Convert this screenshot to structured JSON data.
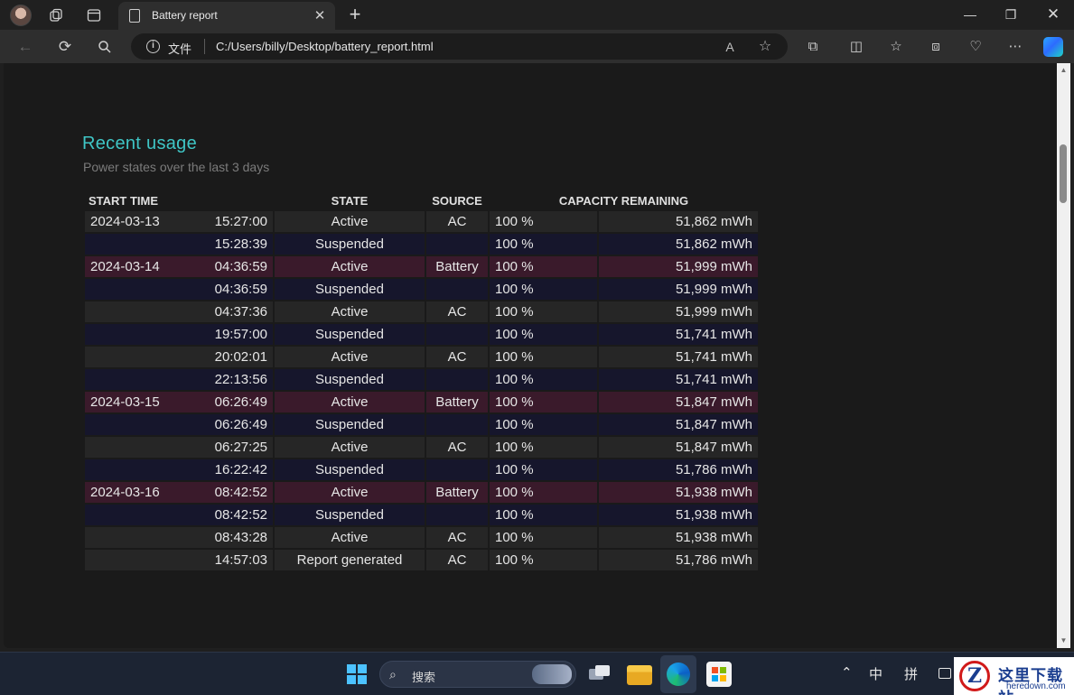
{
  "browser": {
    "tab_title": "Battery report",
    "address_scheme": "文件",
    "address_url": "C:/Users/billy/Desktop/battery_report.html",
    "icons": [
      "profile-avatar",
      "workspaces-icon",
      "tab-actions-icon",
      "page-icon",
      "close-icon",
      "new-tab-icon",
      "minimize-icon",
      "maximize-icon",
      "window-close-icon",
      "back-icon",
      "refresh-icon",
      "search-icon",
      "info-icon",
      "read-aloud-icon",
      "favorite-star-icon",
      "extensions-icon",
      "split-screen-icon",
      "favorites-icon",
      "collections-icon",
      "browser-essentials-icon",
      "more-icon",
      "copilot-icon"
    ]
  },
  "report": {
    "heading": "Recent usage",
    "subheading": "Power states over the last 3 days",
    "columns": {
      "start_time": "START TIME",
      "state": "STATE",
      "source": "SOURCE",
      "capacity": "CAPACITY REMAINING"
    },
    "rows": [
      {
        "date": "2024-03-13",
        "time": "15:27:00",
        "state": "Active",
        "source": "AC",
        "pct": "100 %",
        "mwh": "51,862 mWh",
        "kind": "ac"
      },
      {
        "date": "",
        "time": "15:28:39",
        "state": "Suspended",
        "source": "",
        "pct": "100 %",
        "mwh": "51,862 mWh",
        "kind": "suspended"
      },
      {
        "date": "2024-03-14",
        "time": "04:36:59",
        "state": "Active",
        "source": "Battery",
        "pct": "100 %",
        "mwh": "51,999 mWh",
        "kind": "battery"
      },
      {
        "date": "",
        "time": "04:36:59",
        "state": "Suspended",
        "source": "",
        "pct": "100 %",
        "mwh": "51,999 mWh",
        "kind": "suspended"
      },
      {
        "date": "",
        "time": "04:37:36",
        "state": "Active",
        "source": "AC",
        "pct": "100 %",
        "mwh": "51,999 mWh",
        "kind": "ac"
      },
      {
        "date": "",
        "time": "19:57:00",
        "state": "Suspended",
        "source": "",
        "pct": "100 %",
        "mwh": "51,741 mWh",
        "kind": "suspended"
      },
      {
        "date": "",
        "time": "20:02:01",
        "state": "Active",
        "source": "AC",
        "pct": "100 %",
        "mwh": "51,741 mWh",
        "kind": "ac"
      },
      {
        "date": "",
        "time": "22:13:56",
        "state": "Suspended",
        "source": "",
        "pct": "100 %",
        "mwh": "51,741 mWh",
        "kind": "suspended"
      },
      {
        "date": "2024-03-15",
        "time": "06:26:49",
        "state": "Active",
        "source": "Battery",
        "pct": "100 %",
        "mwh": "51,847 mWh",
        "kind": "battery"
      },
      {
        "date": "",
        "time": "06:26:49",
        "state": "Suspended",
        "source": "",
        "pct": "100 %",
        "mwh": "51,847 mWh",
        "kind": "suspended"
      },
      {
        "date": "",
        "time": "06:27:25",
        "state": "Active",
        "source": "AC",
        "pct": "100 %",
        "mwh": "51,847 mWh",
        "kind": "ac"
      },
      {
        "date": "",
        "time": "16:22:42",
        "state": "Suspended",
        "source": "",
        "pct": "100 %",
        "mwh": "51,786 mWh",
        "kind": "suspended"
      },
      {
        "date": "2024-03-16",
        "time": "08:42:52",
        "state": "Active",
        "source": "Battery",
        "pct": "100 %",
        "mwh": "51,938 mWh",
        "kind": "battery"
      },
      {
        "date": "",
        "time": "08:42:52",
        "state": "Suspended",
        "source": "",
        "pct": "100 %",
        "mwh": "51,938 mWh",
        "kind": "suspended"
      },
      {
        "date": "",
        "time": "08:43:28",
        "state": "Active",
        "source": "AC",
        "pct": "100 %",
        "mwh": "51,938 mWh",
        "kind": "ac"
      },
      {
        "date": "",
        "time": "14:57:03",
        "state": "Report generated",
        "source": "AC",
        "pct": "100 %",
        "mwh": "51,786 mWh",
        "kind": "ac"
      }
    ]
  },
  "colors": {
    "heading": "#3fc6c6",
    "row_ac": "#262626",
    "row_suspended": "#16162c",
    "row_battery": "#3a1a2b"
  },
  "taskbar": {
    "search_placeholder": "搜索",
    "tray_ime_1": "中",
    "tray_ime_2": "拼"
  },
  "watermark": {
    "cn": "这里下载站",
    "en": "heredown.com"
  }
}
